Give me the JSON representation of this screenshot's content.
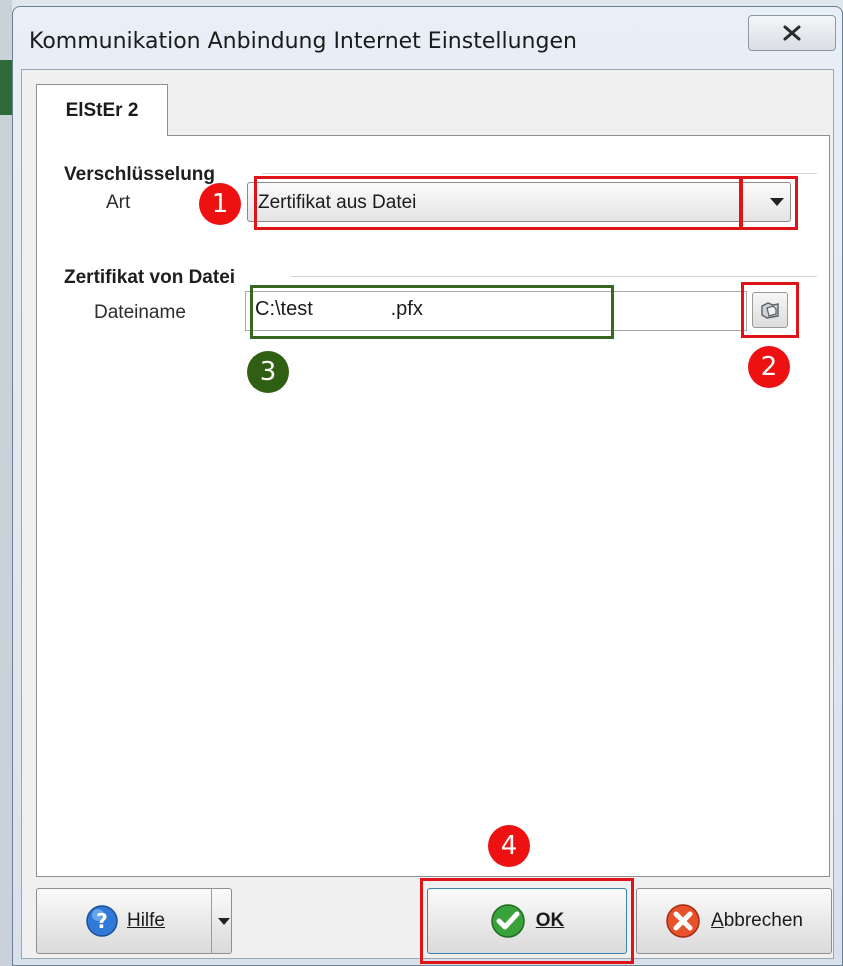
{
  "window": {
    "title": "Kommunikation Anbindung Internet Einstellungen",
    "close_glyph": "X"
  },
  "tabs": [
    {
      "label": "ElStEr 2",
      "selected": true
    }
  ],
  "encryption_group": {
    "title": "Verschlüsselung",
    "art_label": "Art",
    "art_value": "Zertifikat aus Datei"
  },
  "certificate_group": {
    "title": "Zertifikat von Datei",
    "filename_label": "Dateiname",
    "filename_value": "C:\\test              .pfx"
  },
  "buttons": {
    "help": "Hilfe",
    "ok": "OK",
    "cancel": "Abbrechen"
  },
  "annotations": {
    "badge_1": "1",
    "badge_2": "2",
    "badge_3": "3",
    "badge_4": "4",
    "highlight_red": "#e01418",
    "highlight_green": "#36691e"
  },
  "icons": {
    "close": "close-icon",
    "dropdown": "chevron-down-icon",
    "browse": "folder-browse-icon",
    "help": "help-icon",
    "ok": "checkmark-icon",
    "cancel": "cancel-icon"
  }
}
